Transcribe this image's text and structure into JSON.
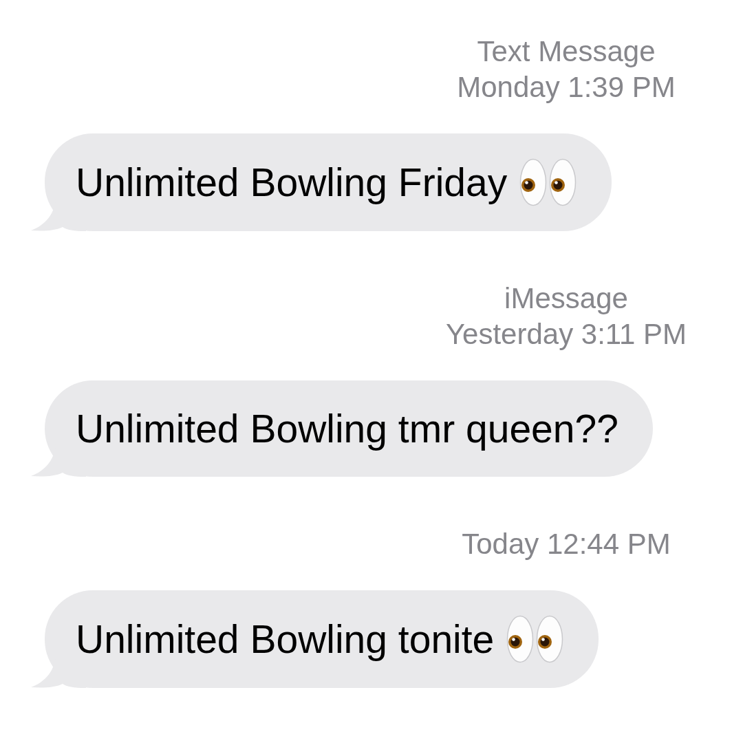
{
  "conversation": [
    {
      "kind": "timestamp",
      "service": "Text Message",
      "time": "Monday 1:39 PM"
    },
    {
      "kind": "message",
      "text": "Unlimited Bowling Friday",
      "eyes_emoji": true
    },
    {
      "kind": "timestamp",
      "service": "iMessage",
      "time": "Yesterday 3:11 PM"
    },
    {
      "kind": "message",
      "text": "Unlimited Bowling tmr queen??",
      "eyes_emoji": false
    },
    {
      "kind": "timestamp",
      "time": "Today 12:44 PM"
    },
    {
      "kind": "message",
      "text": "Unlimited Bowling tonite",
      "eyes_emoji": true
    }
  ]
}
